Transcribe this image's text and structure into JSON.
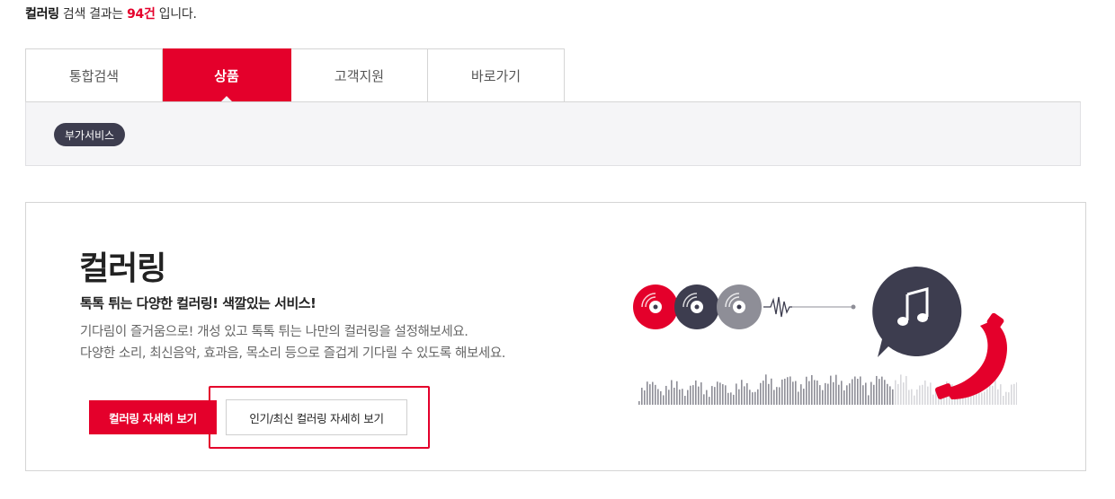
{
  "summary": {
    "keyword": "컬러링",
    "middle": " 검색 결과는 ",
    "count": "94건",
    "suffix": " 입니다."
  },
  "tabs": [
    {
      "label": "통합검색",
      "active": false
    },
    {
      "label": "상품",
      "active": true
    },
    {
      "label": "고객지원",
      "active": false
    },
    {
      "label": "바로가기",
      "active": false
    }
  ],
  "filter": {
    "chip_label": "부가서비스"
  },
  "card": {
    "title": "컬러링",
    "subtitle": "톡톡 튀는 다양한 컬러링! 색깔있는 서비스!",
    "desc_line1": "기다림이 즐거움으로! 개성 있고 톡톡 튀는 나만의 컬러링을 설정해보세요.",
    "desc_line2": "다양한 소리, 최신음악, 효과음, 목소리 등으로 즐겁게 기다릴 수 있도록 해보세요.",
    "primary_button": "컬러링 자세히 보기",
    "secondary_button": "인기/최신 컬러링 자세히 보기"
  },
  "colors": {
    "accent": "#e4002b",
    "dark": "#3d3d4f",
    "gray": "#8e8e97",
    "light_gray": "#d8d8dc"
  },
  "illustration": {
    "icons": [
      "disc-icon",
      "disc-icon",
      "disc-icon",
      "music-note-icon",
      "phone-handset-icon"
    ]
  }
}
